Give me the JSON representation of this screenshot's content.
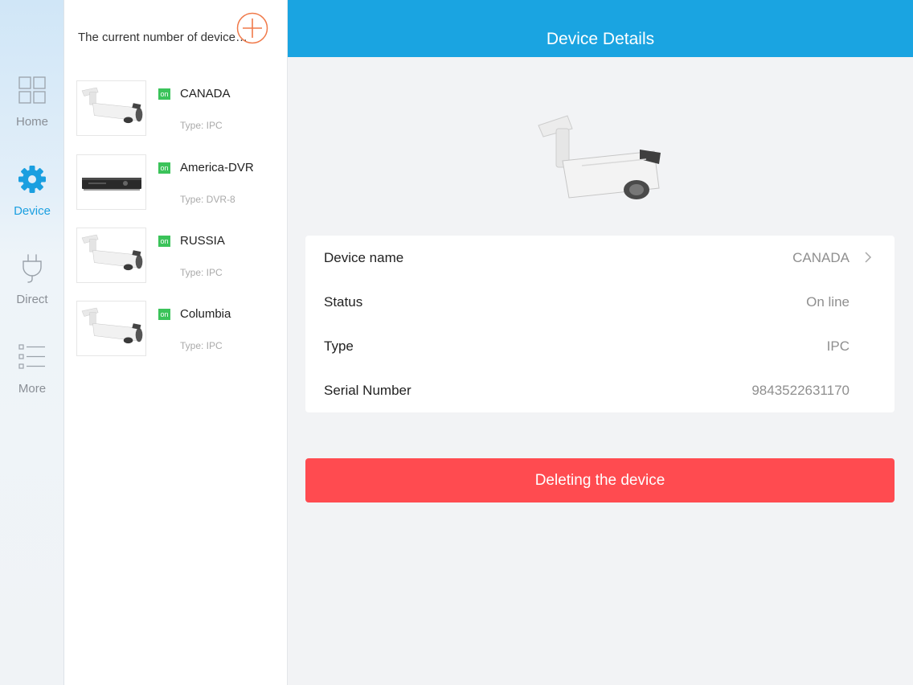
{
  "colors": {
    "accent": "#1aa4e1",
    "danger": "#ff4b50",
    "online": "#3bc35a",
    "add": "#f07a4a"
  },
  "nav": [
    {
      "label": "Home",
      "icon": "grid-icon"
    },
    {
      "label": "Device",
      "icon": "gear-icon",
      "active": true
    },
    {
      "label": "Direct",
      "icon": "plug-icon"
    },
    {
      "label": "More",
      "icon": "list-icon"
    }
  ],
  "device_list": {
    "header": "The current number of devices...",
    "add_icon": "plus-circle-icon",
    "devices": [
      {
        "name": "CANADA",
        "status": "on",
        "type": "Type: IPC",
        "thumbnail": "bullet-camera"
      },
      {
        "name": "America-DVR",
        "status": "on",
        "type": "Type: DVR-8",
        "thumbnail": "dvr-recorder"
      },
      {
        "name": "RUSSIA",
        "status": "on",
        "type": "Type: IPC",
        "thumbnail": "bullet-camera"
      },
      {
        "name": "Columbia",
        "status": "on",
        "type": "Type: IPC",
        "thumbnail": "bullet-camera"
      }
    ]
  },
  "details": {
    "title": "Device Details",
    "image": "bullet-camera",
    "rows": [
      {
        "label": "Device name",
        "value": "CANADA"
      },
      {
        "label": "Status",
        "value": "On line"
      },
      {
        "label": "Type",
        "value": "IPC"
      },
      {
        "label": "Serial Number",
        "value": "9843522631170"
      }
    ],
    "delete_label": "Deleting the device"
  }
}
